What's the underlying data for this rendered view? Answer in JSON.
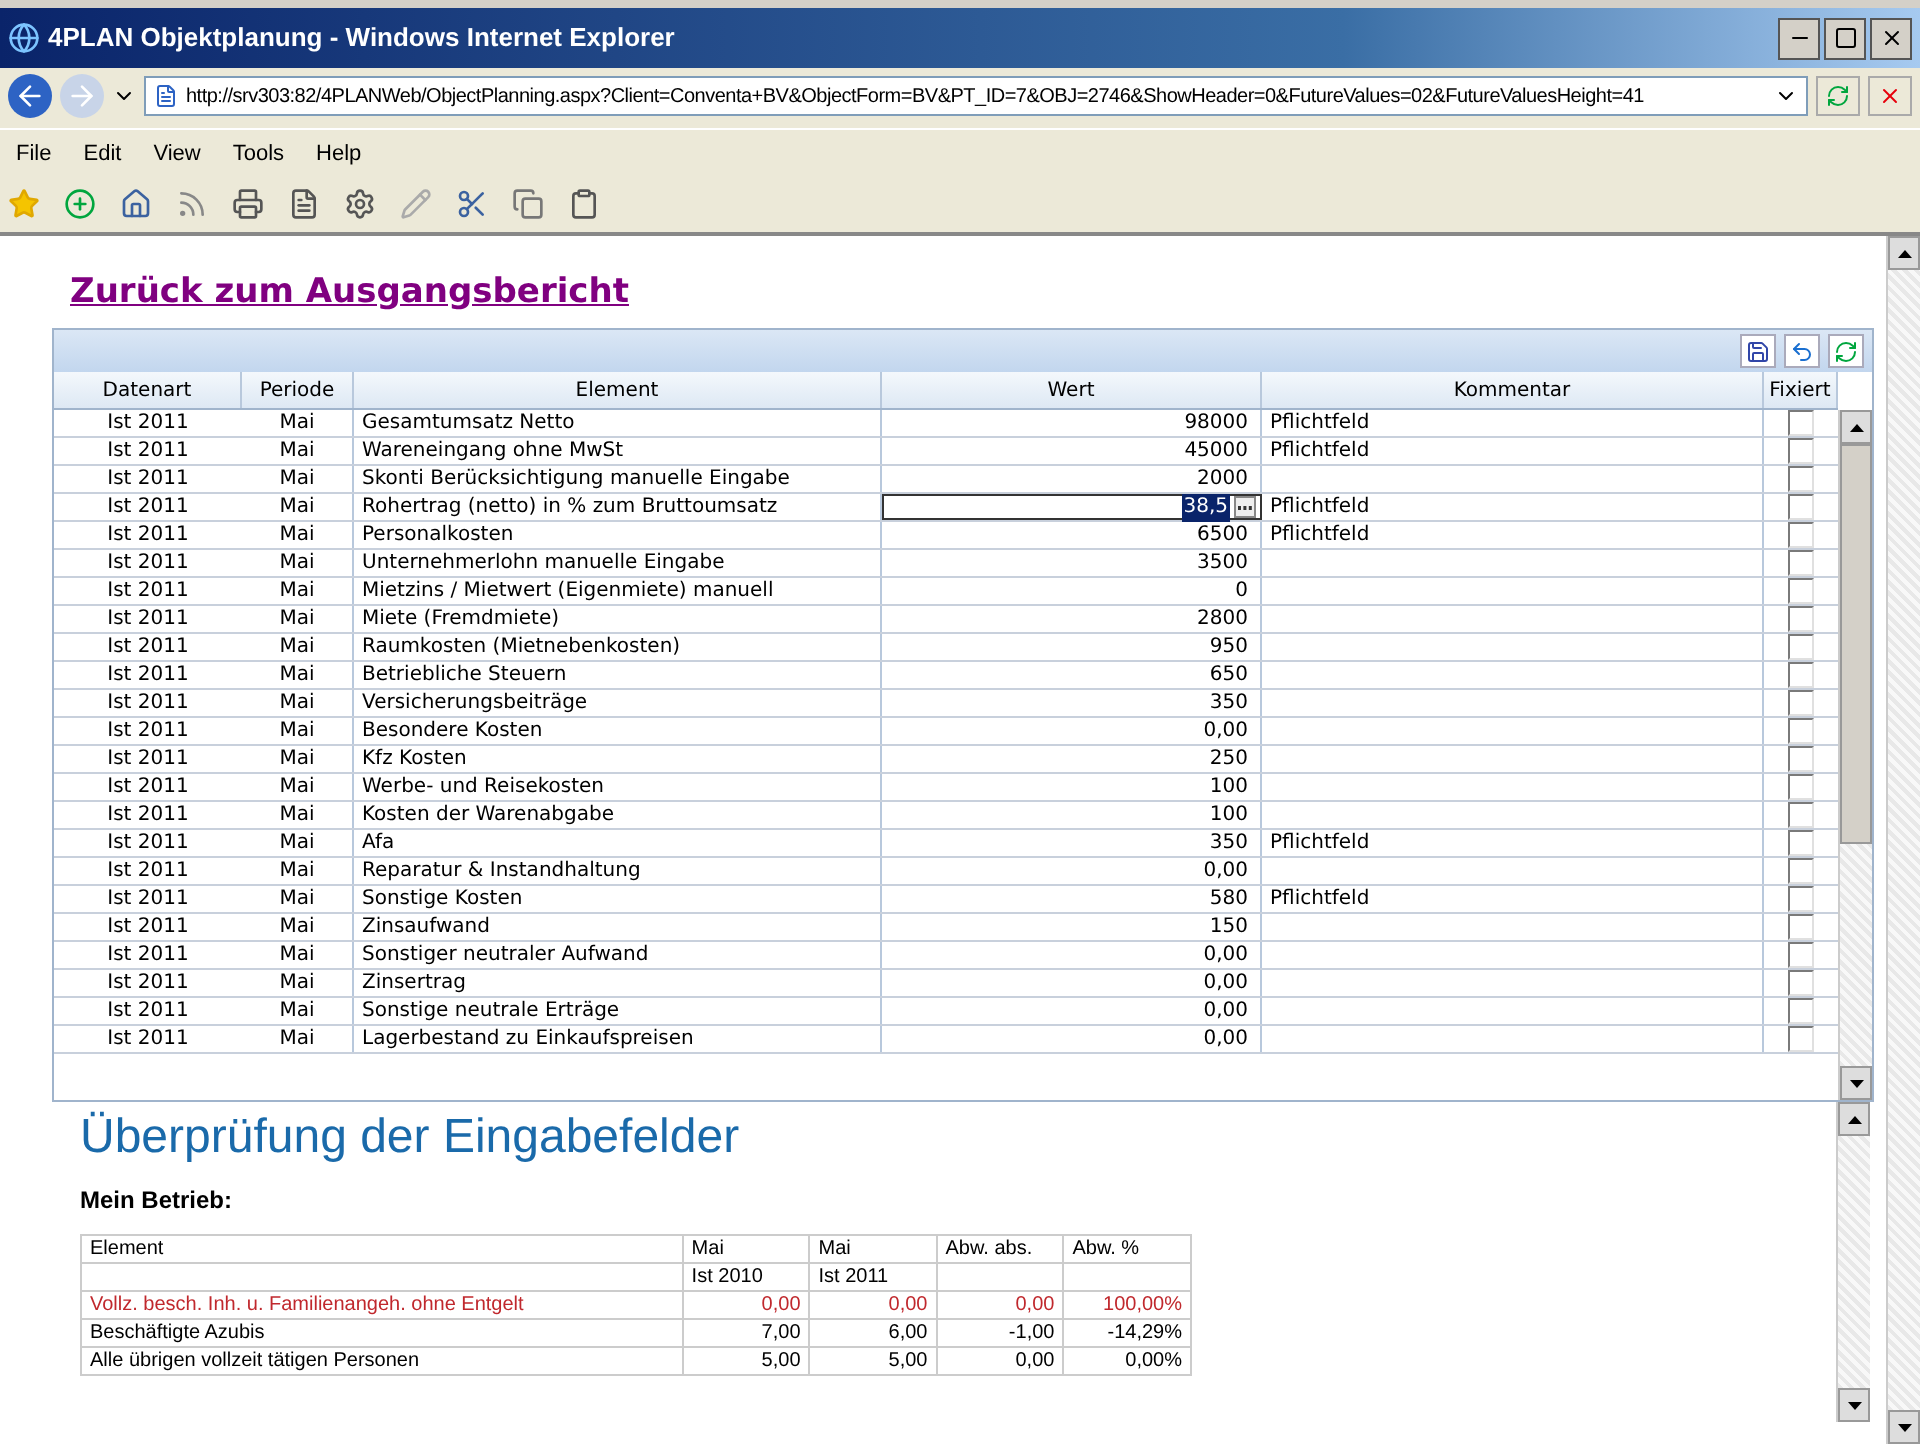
{
  "window": {
    "title": "4PLAN Objektplanung - Windows Internet Explorer"
  },
  "address": {
    "url": "http://srv303:82/4PLANWeb/ObjectPlanning.aspx?Client=Conventa+BV&ObjectForm=BV&PT_ID=7&OBJ=2746&ShowHeader=0&FutureValues=02&FutureValuesHeight=41"
  },
  "menu": [
    "File",
    "Edit",
    "View",
    "Tools",
    "Help"
  ],
  "back_link": "Zurück zum Ausgangsbericht",
  "grid": {
    "columns": [
      "Datenart",
      "Periode",
      "Element",
      "Wert",
      "Kommentar",
      "Fixiert"
    ],
    "rows": [
      {
        "datenart": "Ist 2011",
        "periode": "Mai",
        "element": "Gesamtumsatz Netto",
        "wert": "98000",
        "kommentar": "Pflichtfeld",
        "fixiert": false,
        "editing": false
      },
      {
        "datenart": "Ist 2011",
        "periode": "Mai",
        "element": "Wareneingang ohne MwSt",
        "wert": "45000",
        "kommentar": "Pflichtfeld",
        "fixiert": false,
        "editing": false
      },
      {
        "datenart": "Ist 2011",
        "periode": "Mai",
        "element": "Skonti Berücksichtigung manuelle Eingabe",
        "wert": "2000",
        "fixiert": false,
        "editing": false
      },
      {
        "datenart": "Ist 2011",
        "periode": "Mai",
        "element": "Rohertrag (netto) in % zum Bruttoumsatz",
        "wert": "38,5",
        "kommentar": "Pflichtfeld",
        "fixiert": false,
        "editing": true
      },
      {
        "datenart": "Ist 2011",
        "periode": "Mai",
        "element": "Personalkosten",
        "wert": "6500",
        "kommentar": "Pflichtfeld",
        "fixiert": false,
        "editing": false
      },
      {
        "datenart": "Ist 2011",
        "periode": "Mai",
        "element": "Unternehmerlohn manuelle Eingabe",
        "wert": "3500",
        "fixiert": false,
        "editing": false
      },
      {
        "datenart": "Ist 2011",
        "periode": "Mai",
        "element": "Mietzins / Mietwert (Eigenmiete) manuell",
        "wert": "0",
        "fixiert": false,
        "editing": false
      },
      {
        "datenart": "Ist 2011",
        "periode": "Mai",
        "element": "Miete (Fremdmiete)",
        "wert": "2800",
        "fixiert": false,
        "editing": false
      },
      {
        "datenart": "Ist 2011",
        "periode": "Mai",
        "element": "Raumkosten (Mietnebenkosten)",
        "wert": "950",
        "fixiert": false,
        "editing": false
      },
      {
        "datenart": "Ist 2011",
        "periode": "Mai",
        "element": "Betriebliche Steuern",
        "wert": "650",
        "fixiert": false,
        "editing": false
      },
      {
        "datenart": "Ist 2011",
        "periode": "Mai",
        "element": "Versicherungsbeiträge",
        "wert": "350",
        "fixiert": false,
        "editing": false
      },
      {
        "datenart": "Ist 2011",
        "periode": "Mai",
        "element": "Besondere Kosten",
        "wert": "0,00",
        "fixiert": false,
        "editing": false
      },
      {
        "datenart": "Ist 2011",
        "periode": "Mai",
        "element": "Kfz Kosten",
        "wert": "250",
        "fixiert": false,
        "editing": false
      },
      {
        "datenart": "Ist 2011",
        "periode": "Mai",
        "element": "Werbe- und Reisekosten",
        "wert": "100",
        "fixiert": false,
        "editing": false
      },
      {
        "datenart": "Ist 2011",
        "periode": "Mai",
        "element": "Kosten der Warenabgabe",
        "wert": "100",
        "fixiert": false,
        "editing": false
      },
      {
        "datenart": "Ist 2011",
        "periode": "Mai",
        "element": "Afa",
        "wert": "350",
        "kommentar": "Pflichtfeld",
        "fixiert": false,
        "editing": false
      },
      {
        "datenart": "Ist 2011",
        "periode": "Mai",
        "element": "Reparatur & Instandhaltung",
        "wert": "0,00",
        "fixiert": false,
        "editing": false
      },
      {
        "datenart": "Ist 2011",
        "periode": "Mai",
        "element": "Sonstige Kosten",
        "wert": "580",
        "kommentar": "Pflichtfeld",
        "fixiert": false,
        "editing": false
      },
      {
        "datenart": "Ist 2011",
        "periode": "Mai",
        "element": "Zinsaufwand",
        "wert": "150",
        "fixiert": false,
        "editing": false
      },
      {
        "datenart": "Ist 2011",
        "periode": "Mai",
        "element": "Sonstiger neutraler Aufwand",
        "wert": "0,00",
        "fixiert": false,
        "editing": false
      },
      {
        "datenart": "Ist 2011",
        "periode": "Mai",
        "element": "Zinsertrag",
        "wert": "0,00",
        "fixiert": false,
        "editing": false
      },
      {
        "datenart": "Ist 2011",
        "periode": "Mai",
        "element": "Sonstige neutrale Erträge",
        "wert": "0,00",
        "fixiert": false,
        "editing": false
      },
      {
        "datenart": "Ist 2011",
        "periode": "Mai",
        "element": "Lagerbestand zu Einkaufspreisen",
        "wert": "0,00",
        "fixiert": false,
        "editing": false
      }
    ]
  },
  "check": {
    "title": "Überprüfung der Eingabefelder",
    "subtitle": "Mein Betrieb:",
    "columns": [
      {
        "top": "Element"
      },
      {
        "top": "Mai",
        "bottom": "Ist 2010"
      },
      {
        "top": "Mai",
        "bottom": "Ist 2011"
      },
      {
        "top": "Abw. abs."
      },
      {
        "top": "Abw. %"
      }
    ],
    "rows": [
      {
        "cells": [
          "Vollz. besch. Inh. u. Familienangeh. ohne Entgelt",
          "0,00",
          "0,00",
          "0,00",
          "100,00%"
        ],
        "flagged": true
      },
      {
        "cells": [
          "Beschäftigte Azubis",
          "7,00",
          "6,00",
          "-1,00",
          "-14,29%"
        ],
        "flagged": false
      },
      {
        "cells": [
          "Alle übrigen vollzeit tätigen Personen",
          "5,00",
          "5,00",
          "0,00",
          "0,00%"
        ],
        "flagged": false
      }
    ]
  }
}
